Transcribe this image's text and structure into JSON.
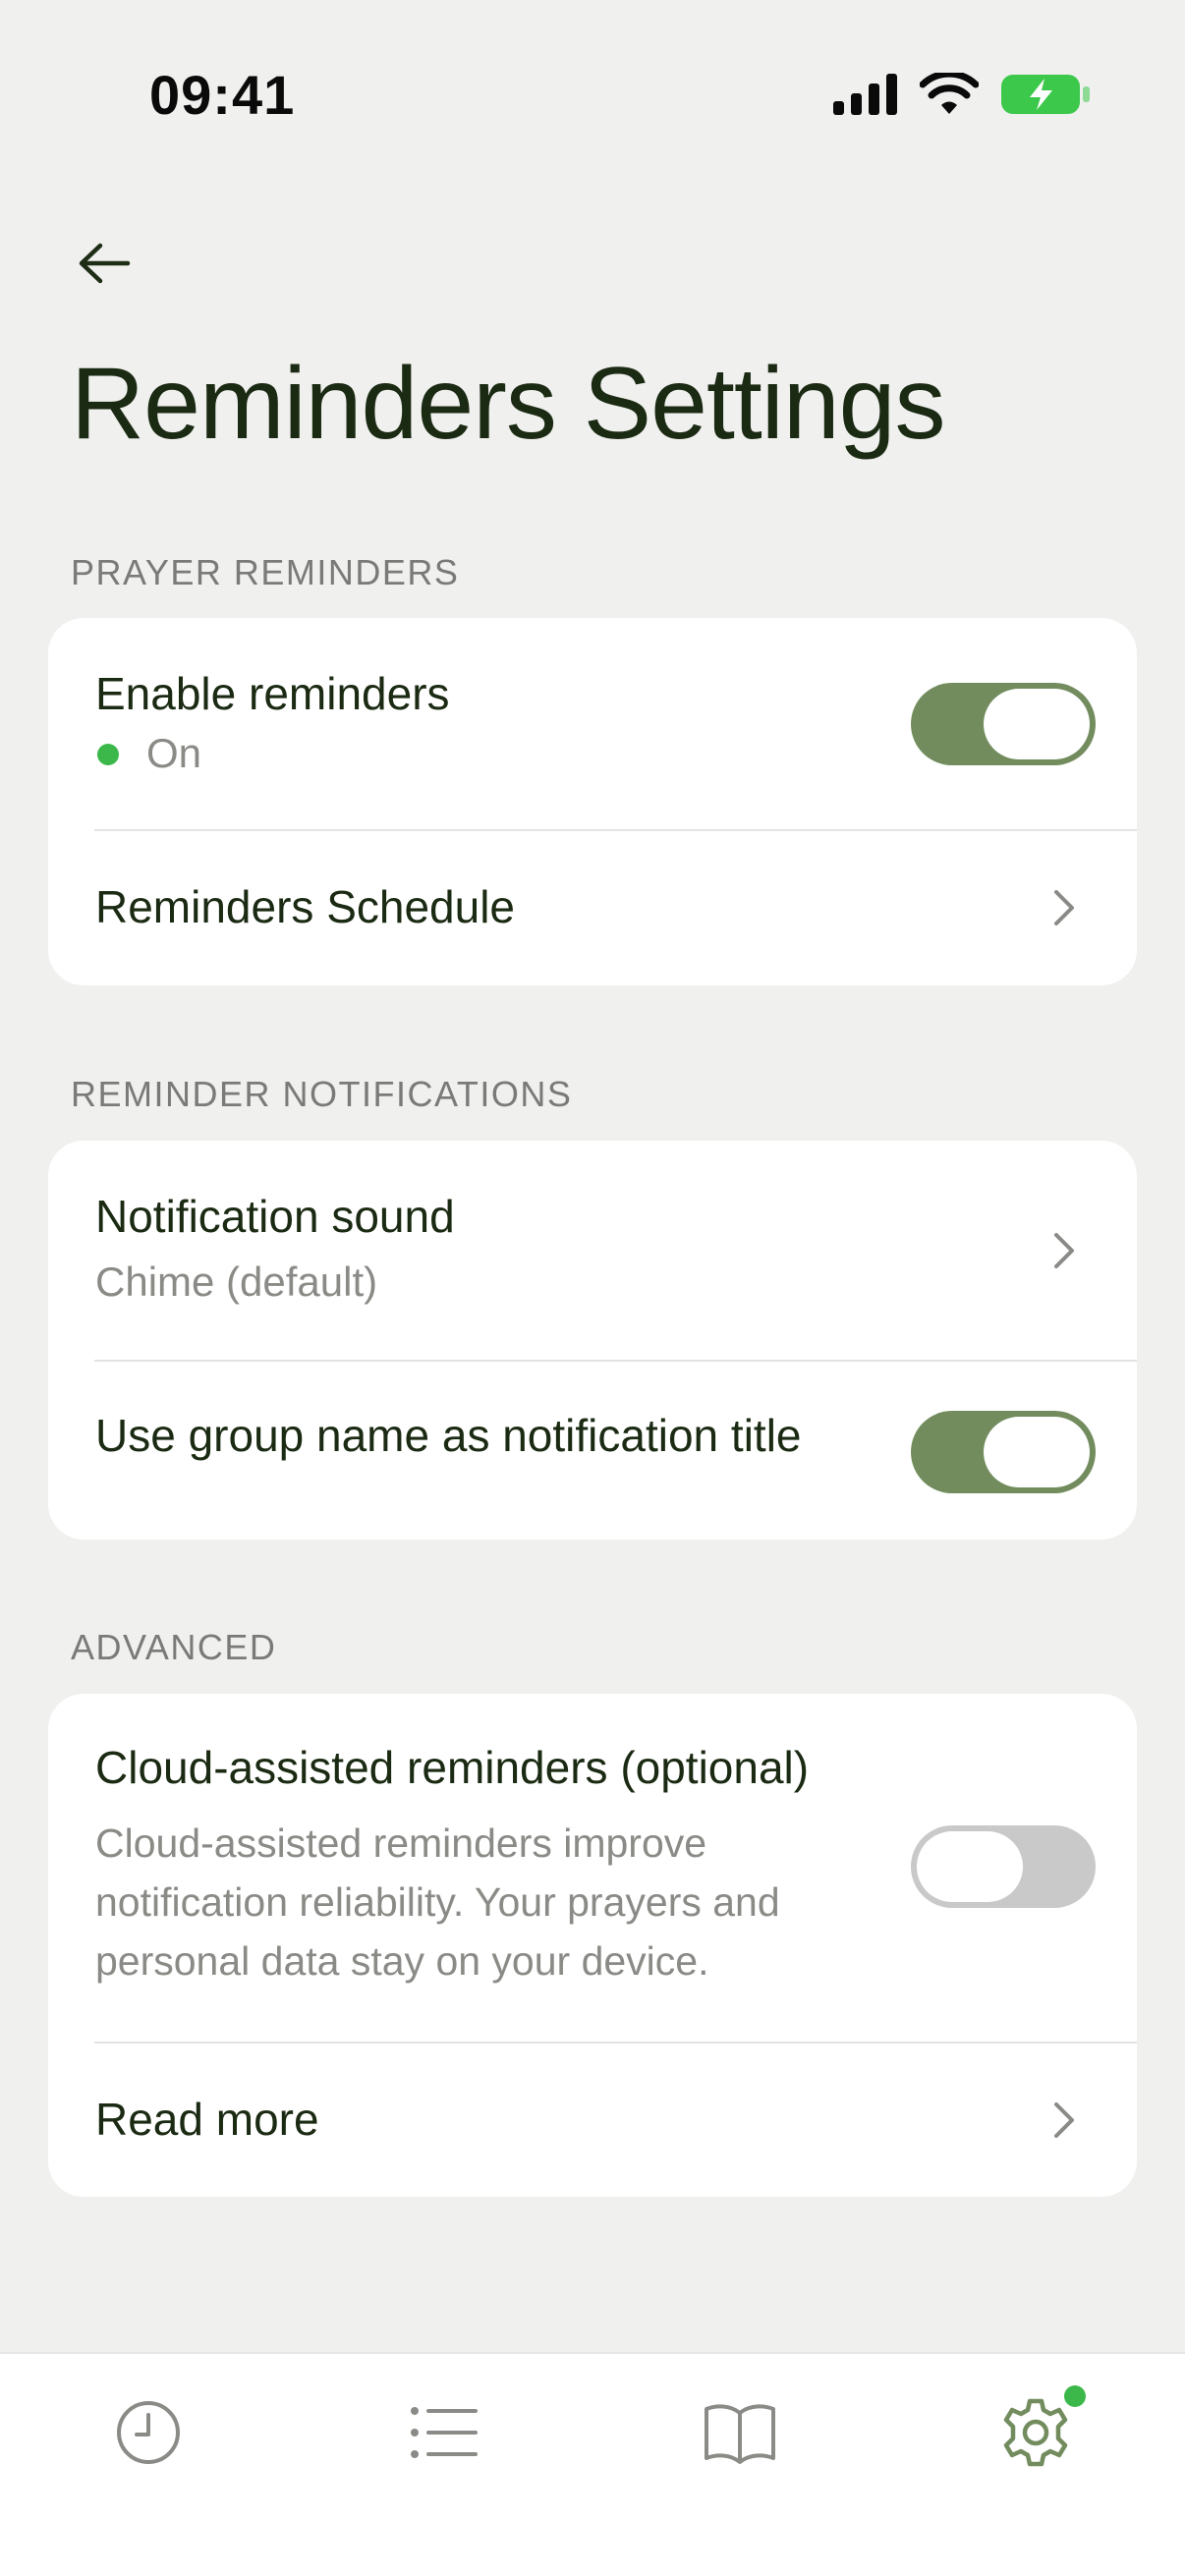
{
  "status_bar": {
    "time": "09:41",
    "icons": [
      "signal-icon",
      "wifi-icon",
      "battery-charging-icon"
    ]
  },
  "header": {
    "back_icon": "arrow-left-icon",
    "title": "Reminders Settings"
  },
  "sections": {
    "prayer_reminders": {
      "label": "PRAYER REMINDERS",
      "enable": {
        "title": "Enable reminders",
        "status": "On",
        "toggle_on": true
      },
      "schedule": {
        "title": "Reminders Schedule"
      }
    },
    "reminder_notifications": {
      "label": "REMINDER NOTIFICATIONS",
      "sound": {
        "title": "Notification sound",
        "value": "Chime (default)"
      },
      "group_name": {
        "title": "Use group name as notification title",
        "toggle_on": true
      }
    },
    "advanced": {
      "label": "ADVANCED",
      "cloud": {
        "title": "Cloud-assisted reminders (optional)",
        "description": "Cloud-assisted reminders improve notification reliability. Your prayers and personal data stay on your device.",
        "toggle_on": false
      },
      "read_more": {
        "title": "Read more"
      }
    }
  },
  "tab_bar": {
    "tabs": [
      "clock-icon",
      "list-icon",
      "book-icon",
      "gear-icon"
    ],
    "active": "gear-icon"
  },
  "colors": {
    "accent": "#738C5E",
    "status_dot": "#3CB84A",
    "toggle_off": "#C9C9C9",
    "title": "#1B2A12",
    "secondary": "#8A8A86"
  }
}
